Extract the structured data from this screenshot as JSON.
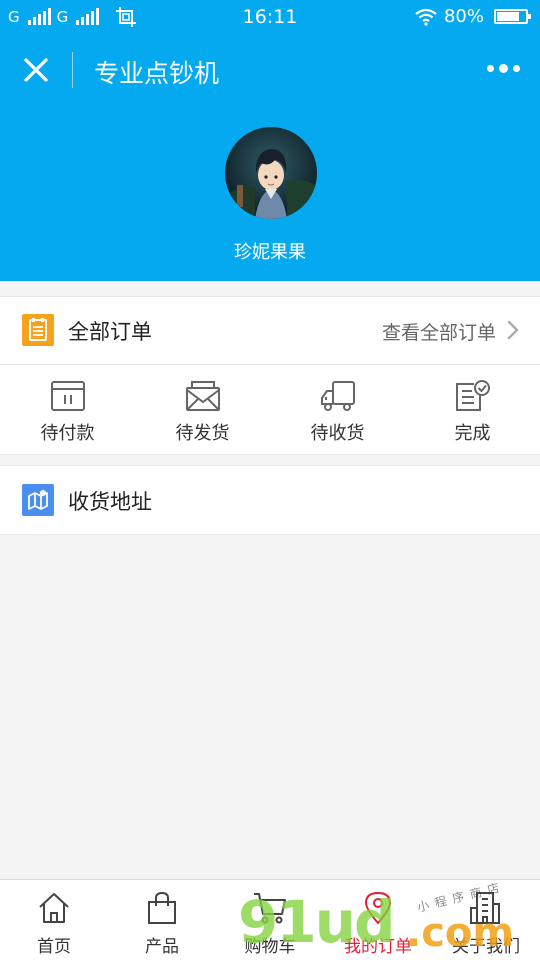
{
  "status_bar": {
    "carrier1": "G",
    "carrier2": "G",
    "time": "16:11",
    "battery": "80%",
    "battery_level": 0.8
  },
  "navbar": {
    "title": "专业点钞机",
    "close_icon": "close-icon",
    "more_icon": "more-dots-icon"
  },
  "profile": {
    "username": "珍妮果果",
    "avatar_icon": "avatar"
  },
  "orders": {
    "title": "全部订单",
    "view_all": "查看全部订单",
    "statuses": [
      {
        "label": "待付款",
        "icon": "wallet-icon"
      },
      {
        "label": "待发货",
        "icon": "envelope-icon"
      },
      {
        "label": "待收货",
        "icon": "truck-icon"
      },
      {
        "label": "完成",
        "icon": "check-document-icon"
      }
    ]
  },
  "address": {
    "title": "收货地址"
  },
  "tabbar": {
    "items": [
      {
        "label": "首页",
        "icon": "home-icon"
      },
      {
        "label": "产品",
        "icon": "bag-icon"
      },
      {
        "label": "购物车",
        "icon": "cart-icon"
      },
      {
        "label": "我的订单",
        "icon": "location-pin-icon"
      },
      {
        "label": "关于我们",
        "icon": "building-icon"
      }
    ],
    "active_index": 3
  },
  "watermark": {
    "main": "91ud",
    "suffix": ".com",
    "sub": "小程序商店"
  },
  "colors": {
    "primary": "#05a9f0",
    "active_tab": "#e0213a",
    "orders_icon": "#f7a21b",
    "address_icon": "#4a8ff0"
  }
}
